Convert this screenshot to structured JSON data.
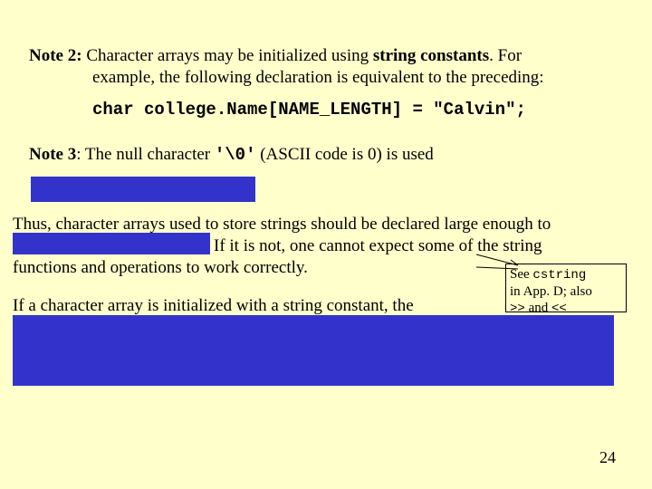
{
  "note2": {
    "label": "Note 2:",
    "line1": " Character arrays may be initialized using ",
    "strong": "string constants",
    "line1b": ". For",
    "line2": "example, the following declaration is equivalent to the preceding:"
  },
  "code": "char college.Name[NAME_LENGTH] = \"Calvin\";",
  "note3": {
    "label": "Note 3",
    "after": ":  The null character ",
    "nullchar": "'\\0'",
    "rest": " (ASCII code is 0) is used"
  },
  "thus": {
    "line1": "Thus, character arrays used to store strings should be declared large enough to",
    "line2": "If it is not, one cannot expect some of the string",
    "line3": "functions and operations to work correctly."
  },
  "ifchar": "If a character array is initialized with a string constant, the",
  "callout": {
    "l1a": "See ",
    "l1b": "cstring",
    "l2": "in App. D; also",
    "l3a": ">>",
    "l3b": " and ",
    "l3c": "<<"
  },
  "pagenum": "24"
}
